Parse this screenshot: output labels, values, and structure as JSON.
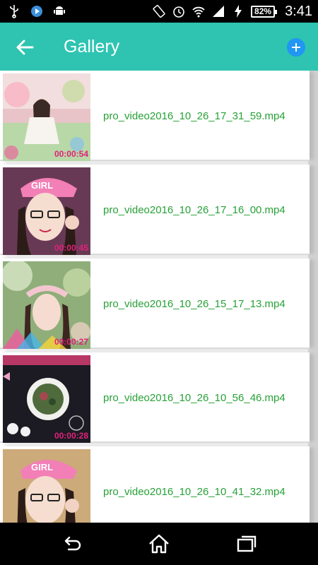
{
  "status_bar": {
    "battery": "82%",
    "time": "3:41",
    "icons": [
      "usb-icon",
      "media-play-icon",
      "android-icon",
      "rotate-icon",
      "alarm-icon",
      "wifi-icon",
      "signal-icon",
      "charging-icon"
    ]
  },
  "app_bar": {
    "title": "Gallery",
    "back_icon": "arrow-back-icon",
    "add_icon": "add-icon",
    "color": "#2ec4b1"
  },
  "gallery": {
    "items": [
      {
        "filename": "pro_video2016_10_26_17_31_59.mp4",
        "duration": "00:00:54",
        "thumb": "girl-seated-garden"
      },
      {
        "filename": "pro_video2016_10_26_17_16_00.mp4",
        "duration": "00:00:45",
        "thumb": "girl-pink-cap"
      },
      {
        "filename": "pro_video2016_10_26_15_17_13.mp4",
        "duration": "00:00:27",
        "thumb": "girl-flower-crown"
      },
      {
        "filename": "pro_video2016_10_26_10_56_46.mp4",
        "duration": "00:00:28",
        "thumb": "food-bowl"
      },
      {
        "filename": "pro_video2016_10_26_10_41_32.mp4",
        "duration": "",
        "thumb": "girl-pink-cap"
      }
    ],
    "filename_color": "#27a137"
  },
  "nav_bar": {
    "icons": [
      "back-nav-icon",
      "home-icon",
      "recent-apps-icon"
    ]
  }
}
